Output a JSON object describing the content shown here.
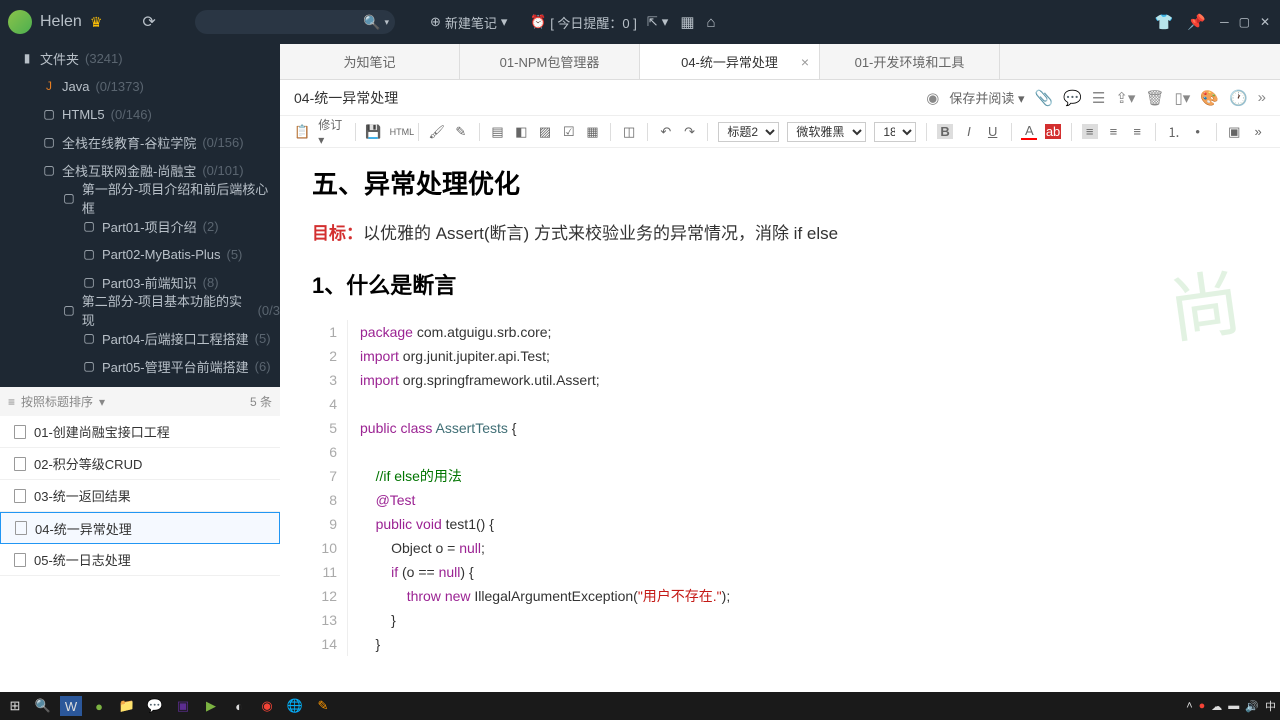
{
  "titlebar": {
    "username": "Helen",
    "newNote": "新建笔记",
    "reminder": "[ 今日提醒：0 ]"
  },
  "sidebar": {
    "root": {
      "label": "文件夹",
      "count": "(3241)"
    },
    "items": [
      {
        "icon": "J",
        "label": "Java",
        "count": "(0/1373)"
      },
      {
        "icon": "▢",
        "label": "HTML5",
        "count": "(0/146)"
      },
      {
        "icon": "▢",
        "label": "全栈在线教育-谷粒学院",
        "count": "(0/156)"
      },
      {
        "icon": "▢",
        "label": "全栈互联网金融-尚融宝",
        "count": "(0/101)"
      }
    ],
    "sub1": {
      "label": "第一部分-项目介绍和前后端核心框",
      "count": ""
    },
    "sub1items": [
      {
        "label": "Part01-项目介绍",
        "count": "(2)"
      },
      {
        "label": "Part02-MyBatis-Plus",
        "count": "(5)"
      },
      {
        "label": "Part03-前端知识",
        "count": "(8)"
      }
    ],
    "sub2": {
      "label": "第二部分-项目基本功能的实现",
      "count": "(0/3"
    },
    "sub2items": [
      {
        "label": "Part04-后端接口工程搭建",
        "count": "(5)"
      },
      {
        "label": "Part05-管理平台前端搭建",
        "count": "(6)"
      }
    ]
  },
  "sortbar": {
    "label": "按照标题排序",
    "count": "5 条"
  },
  "notelist": [
    "01-创建尚融宝接口工程",
    "02-积分等级CRUD",
    "03-统一返回结果",
    "04-统一异常处理",
    "05-统一日志处理"
  ],
  "tabs": [
    "为知笔记",
    "01-NPM包管理器",
    "04-统一异常处理",
    "01-开发环境和工具"
  ],
  "doc": {
    "title": "04-统一异常处理",
    "saveRead": "保存并阅读",
    "toolbar": {
      "revise": "修订",
      "heading": "标题2",
      "font": "微软雅黑",
      "size": "18"
    },
    "h2": "五、异常处理优化",
    "goalLabel": "目标：",
    "goalText": "以优雅的 Assert(断言) 方式来校验业务的异常情况，消除 if else",
    "h3": "1、什么是断言"
  },
  "code": {
    "lines": [
      {
        "n": 1,
        "h": "<span class='kw'>package</span> com.atguigu.srb.core;"
      },
      {
        "n": 2,
        "h": "<span class='kw'>import</span> org.junit.jupiter.api.Test;"
      },
      {
        "n": 3,
        "h": "<span class='kw'>import</span> org.springframework.util.Assert;"
      },
      {
        "n": 4,
        "h": ""
      },
      {
        "n": 5,
        "h": "<span class='kw'>public</span> <span class='kw'>class</span> <span class='cls'>AssertTests</span> {"
      },
      {
        "n": 6,
        "h": ""
      },
      {
        "n": 7,
        "h": "    <span class='cmt'>//if else的用法</span>"
      },
      {
        "n": 8,
        "h": "    <span class='ann'>@Test</span>"
      },
      {
        "n": 9,
        "h": "    <span class='kw'>public</span> <span class='kw'>void</span> test1() {"
      },
      {
        "n": 10,
        "h": "        Object o = <span class='kw'>null</span>;"
      },
      {
        "n": 11,
        "h": "        <span class='kw'>if</span> (o == <span class='kw'>null</span>) {"
      },
      {
        "n": 12,
        "h": "            <span class='kw'>throw</span> <span class='kw'>new</span> IllegalArgumentException(<span class='str'>\"用户不存在.\"</span>);"
      },
      {
        "n": 13,
        "h": "        }"
      },
      {
        "n": 14,
        "h": "    }"
      }
    ]
  },
  "tray": {
    "ime": "中"
  }
}
